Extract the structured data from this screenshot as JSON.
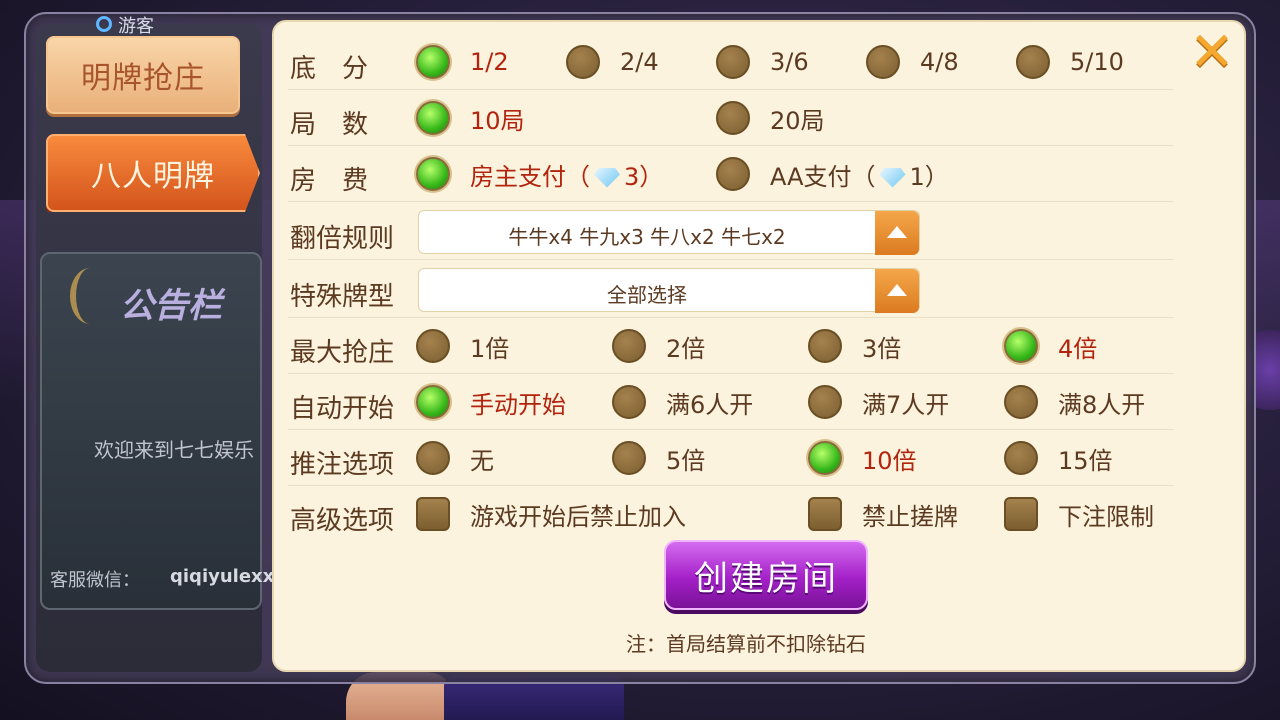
{
  "side": {
    "guest_label": "游客",
    "tabs": [
      {
        "label": "明牌抢庄",
        "active": false
      },
      {
        "label": "八人明牌",
        "active": true
      }
    ],
    "notice_title": "公告栏",
    "welcome": "欢迎来到七七娱乐",
    "wechat_label": "客服微信：",
    "wechat_id": "qiqiyulexx"
  },
  "rows": {
    "base_score": {
      "label": "底分",
      "options": [
        {
          "text": "1/2",
          "selected": true
        },
        {
          "text": "2/4",
          "selected": false
        },
        {
          "text": "3/6",
          "selected": false
        },
        {
          "text": "4/8",
          "selected": false
        },
        {
          "text": "5/10",
          "selected": false
        }
      ]
    },
    "rounds": {
      "label": "局数",
      "options": [
        {
          "text": "10局",
          "selected": true
        },
        {
          "text": "20局",
          "selected": false
        }
      ]
    },
    "fee": {
      "label": "房费",
      "options": [
        {
          "text_prefix": "房主支付（",
          "count": "3",
          "text_suffix": "）",
          "selected": true
        },
        {
          "text_prefix": "AA支付（",
          "count": "1",
          "text_suffix": "）",
          "selected": false
        }
      ]
    },
    "multiplier_rule": {
      "label": "翻倍规则",
      "value": "牛牛x4 牛九x3 牛八x2 牛七x2"
    },
    "special_hands": {
      "label": "特殊牌型",
      "value": "全部选择"
    },
    "max_bid": {
      "label": "最大抢庄",
      "options": [
        {
          "text": "1倍",
          "selected": false
        },
        {
          "text": "2倍",
          "selected": false
        },
        {
          "text": "3倍",
          "selected": false
        },
        {
          "text": "4倍",
          "selected": true
        }
      ]
    },
    "auto_start": {
      "label": "自动开始",
      "options": [
        {
          "text": "手动开始",
          "selected": true
        },
        {
          "text": "满6人开",
          "selected": false
        },
        {
          "text": "满7人开",
          "selected": false
        },
        {
          "text": "满8人开",
          "selected": false
        }
      ]
    },
    "push_bet": {
      "label": "推注选项",
      "options": [
        {
          "text": "无",
          "selected": false
        },
        {
          "text": "5倍",
          "selected": false
        },
        {
          "text": "10倍",
          "selected": true
        },
        {
          "text": "15倍",
          "selected": false
        }
      ]
    },
    "advanced": {
      "label": "高级选项",
      "options": [
        {
          "text": "游戏开始后禁止加入",
          "checked": false
        },
        {
          "text": "禁止搓牌",
          "checked": false
        },
        {
          "text": "下注限制",
          "checked": false
        }
      ]
    }
  },
  "create_button": "创建房间",
  "note": "注：首局结算前不扣除钻石",
  "colors": {
    "panel_bg": "#fbf3dd",
    "text_brown": "#5c3a22",
    "selected_red": "#b2240e",
    "radio_on": "#37b81a",
    "create_purple": "#a420c8",
    "tab_active": "#f88a3d"
  }
}
